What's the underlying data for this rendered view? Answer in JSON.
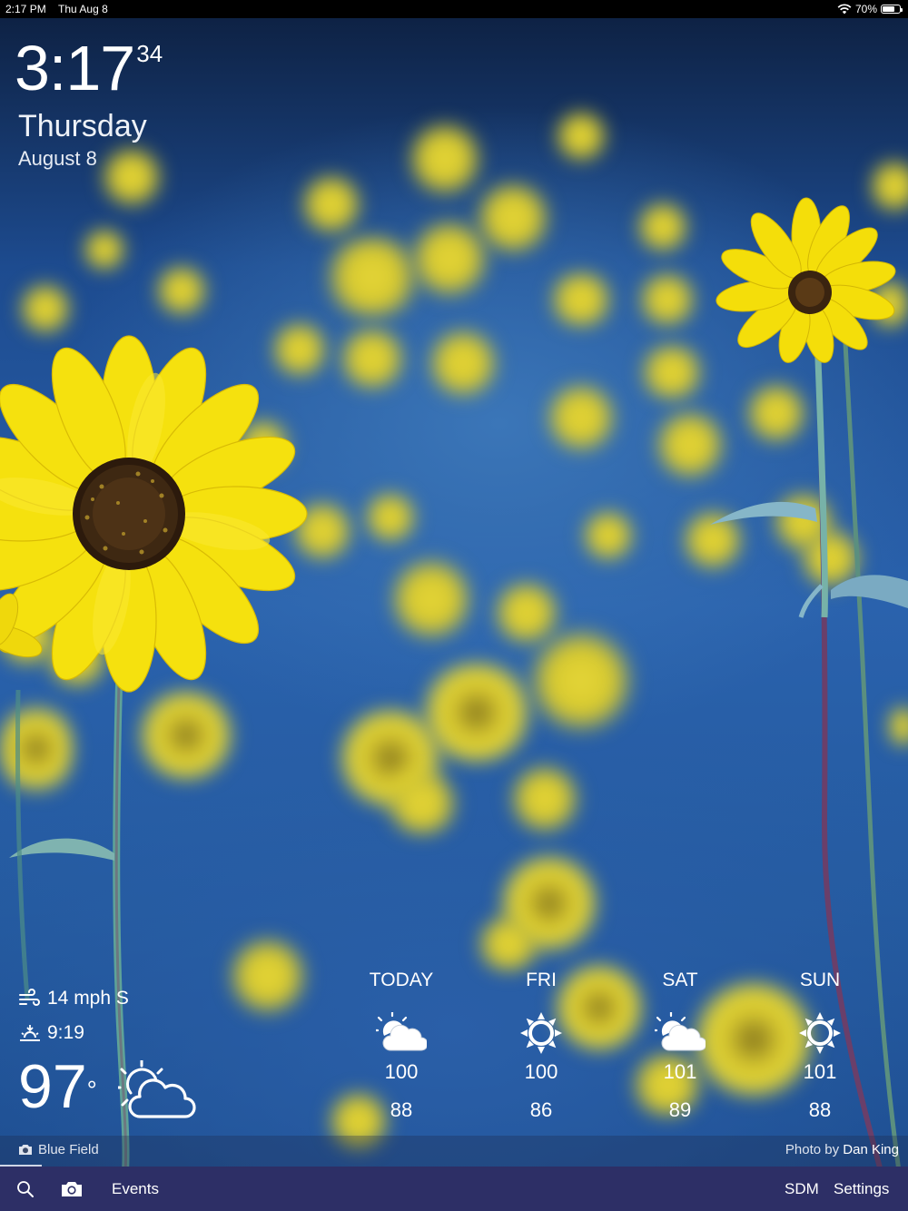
{
  "status_bar": {
    "time": "2:17 PM",
    "date": "Thu Aug 8",
    "battery": "70%",
    "battery_level": 0.7
  },
  "clock": {
    "time": "3:17",
    "seconds": "34",
    "weekday": "Thursday",
    "date": "August 8"
  },
  "current": {
    "wind": "14 mph S",
    "sunset": "9:19",
    "temperature": "97",
    "degree": "°",
    "icon": "partly-cloudy-icon"
  },
  "forecast": [
    {
      "day": "TODAY",
      "icon": "partly-cloudy-icon",
      "high": "100",
      "low": "88"
    },
    {
      "day": "FRI",
      "icon": "sun-icon",
      "high": "100",
      "low": "86"
    },
    {
      "day": "SAT",
      "icon": "partly-cloudy-icon",
      "high": "101",
      "low": "89"
    },
    {
      "day": "SUN",
      "icon": "sun-icon",
      "high": "101",
      "low": "88"
    }
  ],
  "caption": {
    "location": "Blue Field",
    "credit_prefix": "Photo by",
    "credit_name": "Dan King"
  },
  "nav": {
    "events": "Events",
    "sdm": "SDM",
    "settings": "Settings"
  },
  "colors": {
    "nav_background": "#2d2f66",
    "status_bar": "#000000",
    "petal_yellow": "#f4de0a"
  }
}
